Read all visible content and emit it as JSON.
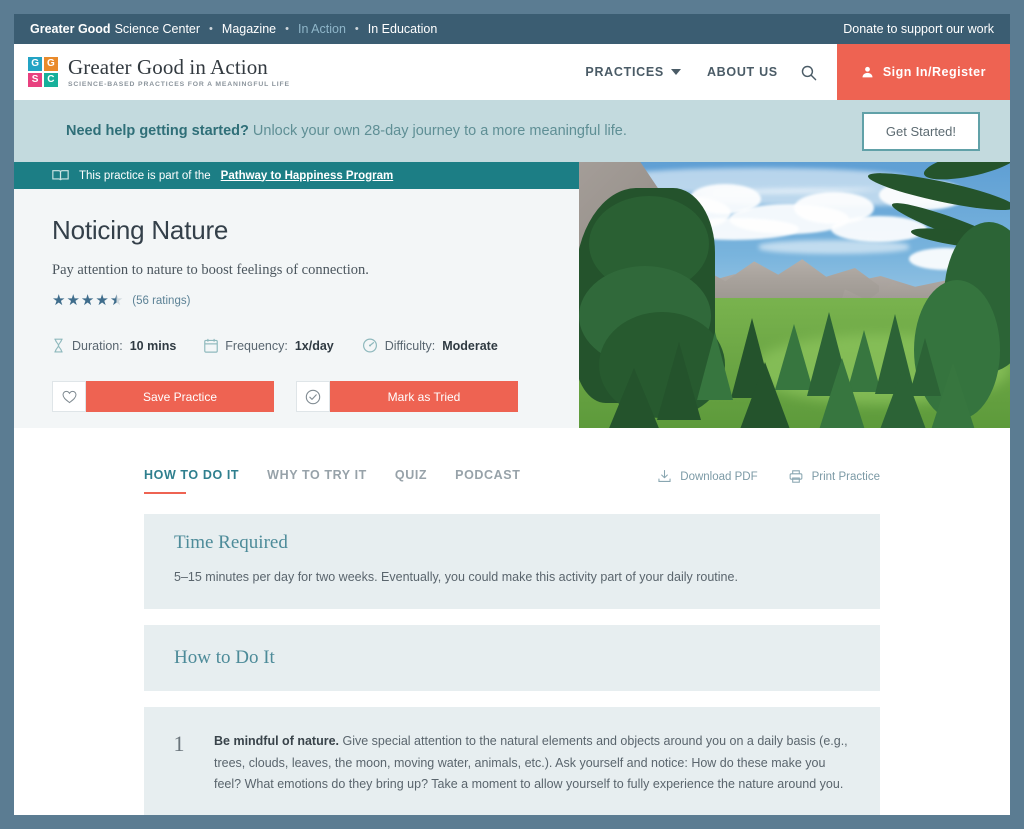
{
  "utility_bar": {
    "brand_strong": "Greater Good",
    "brand_rest": "Science Center",
    "separator": "•",
    "links": [
      {
        "label": "Magazine",
        "active": false
      },
      {
        "label": "In Action",
        "active": true
      },
      {
        "label": "In Education",
        "active": false
      }
    ],
    "donate_label": "Donate to support our work"
  },
  "masthead": {
    "logo_letters": [
      "G",
      "G",
      "S",
      "C"
    ],
    "logo_colors": [
      "#23a3c4",
      "#e98a2b",
      "#e8417f",
      "#17b09a"
    ],
    "title": "Greater Good in Action",
    "tagline": "SCIENCE-BASED PRACTICES FOR A MEANINGFUL LIFE",
    "nav": [
      {
        "label": "PRACTICES",
        "has_caret": true
      },
      {
        "label": "ABOUT US",
        "has_caret": false
      }
    ],
    "search_icon": "search-icon",
    "signin_label": "Sign In/Register",
    "accent_color": "#ee6352"
  },
  "promo": {
    "headline": "Need help getting started?",
    "subline": "Unlock your own 28-day journey to a more meaningful life.",
    "button_label": "Get Started!"
  },
  "hero": {
    "pathway_prefix": "This practice is part of the",
    "pathway_link": "Pathway to Happiness Program",
    "title": "Noticing Nature",
    "subtitle": "Pay attention to nature to boost feelings of connection.",
    "rating_value": 4.5,
    "rating_count_label": "(56 ratings)",
    "meta": [
      {
        "icon": "hourglass-icon",
        "label": "Duration:",
        "value": "10 mins"
      },
      {
        "icon": "calendar-icon",
        "label": "Frequency:",
        "value": "1x/day"
      },
      {
        "icon": "gauge-icon",
        "label": "Difficulty:",
        "value": "Moderate"
      }
    ],
    "save_label": "Save Practice",
    "tried_label": "Mark as Tried",
    "image_alt": "Mountain landscape with rocky peaks, green meadow and pine trees"
  },
  "content": {
    "tabs": [
      {
        "label": "HOW TO DO IT",
        "active": true
      },
      {
        "label": "WHY TO TRY IT",
        "active": false
      },
      {
        "label": "QUIZ",
        "active": false
      },
      {
        "label": "PODCAST",
        "active": false
      }
    ],
    "doc_actions": [
      {
        "icon": "download-pdf-icon",
        "label": "Download PDF"
      },
      {
        "icon": "printer-icon",
        "label": "Print Practice"
      }
    ],
    "time_required": {
      "title": "Time Required",
      "body": "5–15 minutes per day for two weeks. Eventually, you could make this activity part of your daily routine."
    },
    "how_to_do_it": {
      "title": "How to Do It",
      "steps": [
        {
          "number": "1",
          "lead": "Be mindful of nature.",
          "body": "Give special attention to the natural elements and objects around you on a daily basis (e.g., trees, clouds, leaves, the moon, moving water, animals, etc.). Ask yourself and notice: How do these make you feel? What emotions do they bring up? Take a moment to allow yourself to fully experience the nature around you."
        }
      ]
    }
  }
}
